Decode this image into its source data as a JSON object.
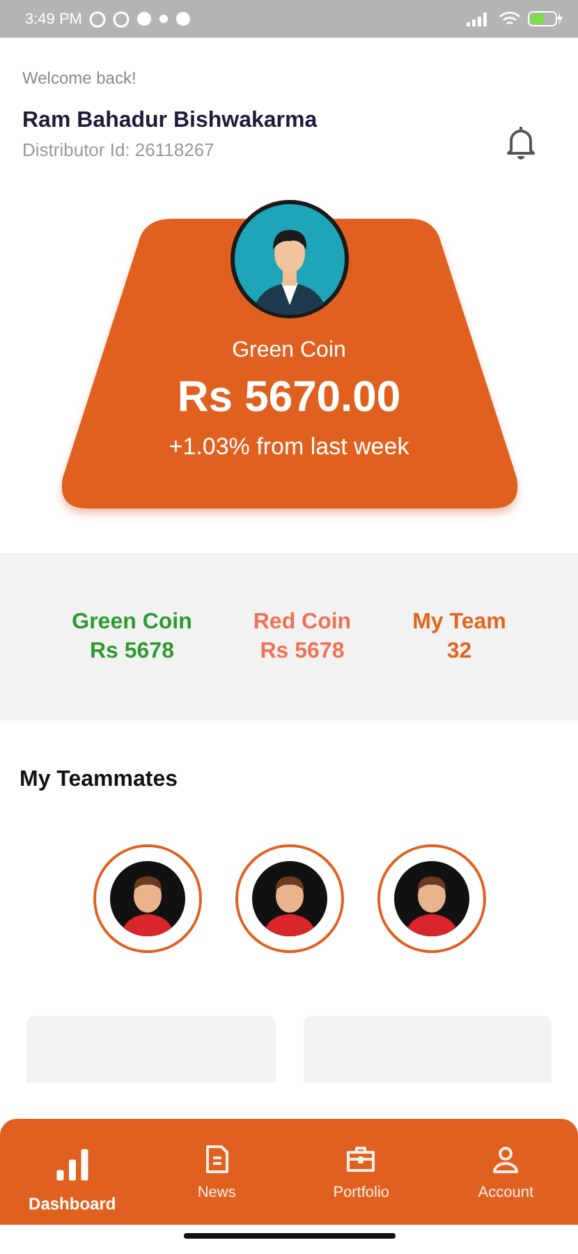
{
  "status_bar": {
    "time": "3:49 PM"
  },
  "header": {
    "greeting": "Welcome back!",
    "name": "Ram Bahadur Bishwakarma",
    "distributor_id": "Distributor Id: 26118267"
  },
  "balance_card": {
    "title": "Green Coin",
    "amount": "Rs 5670.00",
    "change": "+1.03% from last week"
  },
  "stats": [
    {
      "label": "Green Coin",
      "value": "Rs 5678",
      "color": "#2e9a2e"
    },
    {
      "label": "Red Coin",
      "value": "Rs 5678",
      "color": "#ee7255"
    },
    {
      "label": "My Team",
      "value": "32",
      "color": "#e0661f"
    }
  ],
  "teammates": {
    "title": "My Teammates"
  },
  "nav": [
    {
      "label": "Dashboard",
      "kind": "bars",
      "selected": true
    },
    {
      "label": "News",
      "kind": "doc",
      "selected": false
    },
    {
      "label": "Portfolio",
      "kind": "case",
      "selected": false
    },
    {
      "label": "Account",
      "kind": "user",
      "selected": false
    }
  ]
}
